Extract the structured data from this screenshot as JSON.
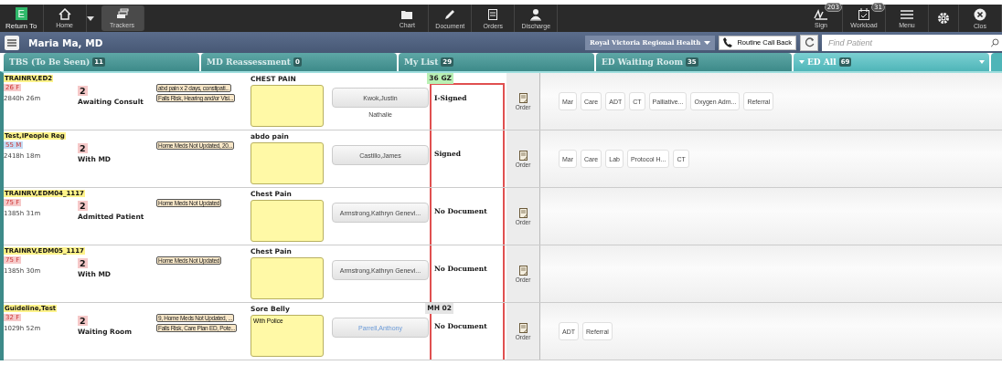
{
  "toolbar": {
    "left": [
      {
        "kind": "app",
        "label": "Return To",
        "glyph": "E",
        "selected": false,
        "menu": false
      },
      {
        "kind": "home",
        "label": "Home",
        "selected": false,
        "menu": true
      },
      {
        "kind": "trackers",
        "label": "Trackers",
        "selected": true,
        "menu": false
      }
    ],
    "center": [
      {
        "kind": "chart",
        "label": "Chart"
      },
      {
        "kind": "document",
        "label": "Document"
      },
      {
        "kind": "orders",
        "label": "Orders"
      },
      {
        "kind": "discharge",
        "label": "Discharge"
      }
    ],
    "right": [
      {
        "kind": "sign",
        "label": "Sign",
        "badge": "203"
      },
      {
        "kind": "workload",
        "label": "Workload",
        "badge": "31"
      },
      {
        "kind": "menu",
        "label": "Menu"
      },
      {
        "kind": "settings"
      },
      {
        "kind": "close",
        "label": "Clos"
      }
    ]
  },
  "header": {
    "user": "Maria Ma, MD",
    "facility": "Royal Victoria Regional Health",
    "call_back": "Routine Call Back",
    "search": {
      "placeholder": "Find Patient"
    }
  },
  "tabs": [
    {
      "label": "TBS (To Be Seen)",
      "count": "11",
      "selected": false
    },
    {
      "label": "MD Reassessment",
      "count": "0",
      "selected": false
    },
    {
      "label": "My List",
      "count": "29",
      "selected": false
    },
    {
      "label": "ED Waiting Room",
      "count": "35",
      "selected": false
    },
    {
      "label": "ED All",
      "count": "69",
      "selected": true
    }
  ],
  "rows": [
    {
      "name": "TRAINRV,ED2",
      "age": {
        "text": "26 F",
        "color": "#f6c9c9"
      },
      "elapsed": "2840h 26m",
      "acuity": "2",
      "status": "Awaiting Consult",
      "comments": [
        "abd pain x 2 days, constipati...",
        "Falls Risk, Hearing and/or Visi..."
      ],
      "complaint": "CHEST PAIN",
      "note": "",
      "room": {
        "text": "36 GZ",
        "color": "#b9f0b4"
      },
      "provider": "Kwok,Justin",
      "provider_highlight": false,
      "provider_2": "Nathalie",
      "document": "I-Signed",
      "order": "Order",
      "tasks": [
        "Mar",
        "Care",
        "ADT",
        "CT",
        "Palliative...",
        "Oxygen Adm...",
        "Referral"
      ]
    },
    {
      "name": "Test,IPeople Reg",
      "age": {
        "text": "55 M",
        "color": "#c3daf3"
      },
      "elapsed": "2418h 18m",
      "acuity": "2",
      "status": "With MD",
      "comments": [
        "Home Meds Not Updated, 20..."
      ],
      "complaint": "abdo pain",
      "note": "",
      "provider": "Castillo,James",
      "provider_highlight": false,
      "provider_2": "",
      "document": "Signed",
      "order": "Order",
      "tasks": [
        "Mar",
        "Care",
        "Lab",
        "Protocol H...",
        "CT"
      ]
    },
    {
      "name": "TRAINRV,EDM04_1117",
      "age": {
        "text": "75 F",
        "color": "#f6c9c9"
      },
      "elapsed": "1385h 31m",
      "acuity": "2",
      "status": "Admitted Patient",
      "comments": [
        "Home Meds Not Updated"
      ],
      "complaint": "Chest Pain",
      "note": "",
      "provider": "Armstrong,Kathryn Genevi...",
      "provider_highlight": false,
      "provider_2": "",
      "document": "No Document",
      "order": "Order",
      "tasks": []
    },
    {
      "name": "TRAINRV,EDM05_1117",
      "age": {
        "text": "75 F",
        "color": "#f6c9c9"
      },
      "elapsed": "1385h 30m",
      "acuity": "2",
      "status": "With MD",
      "comments": [
        "Home Meds Not Updated"
      ],
      "complaint": "Chest Pain",
      "note": "",
      "provider": "Armstrong,Kathryn Genevi...",
      "provider_highlight": false,
      "provider_2": "",
      "document": "No Document",
      "order": "Order",
      "tasks": []
    },
    {
      "name": "Guideline,Test",
      "age": {
        "text": "32 F",
        "color": "#f6c9c9"
      },
      "elapsed": "1029h 52m",
      "acuity": "2",
      "status": "Waiting Room",
      "comments": [
        "9, Home Meds Not Updated, ...",
        "Falls Risk, Care Plan ED, Pote..."
      ],
      "complaint": "Sore Belly",
      "note": "With Police",
      "room": {
        "text": "MH 02",
        "color": "#e4e4e4"
      },
      "provider": "Parrell,Anthony",
      "provider_highlight": true,
      "provider_2": "",
      "document": "No Document",
      "order": "Order",
      "tasks": [
        "ADT",
        "Referral"
      ]
    }
  ]
}
